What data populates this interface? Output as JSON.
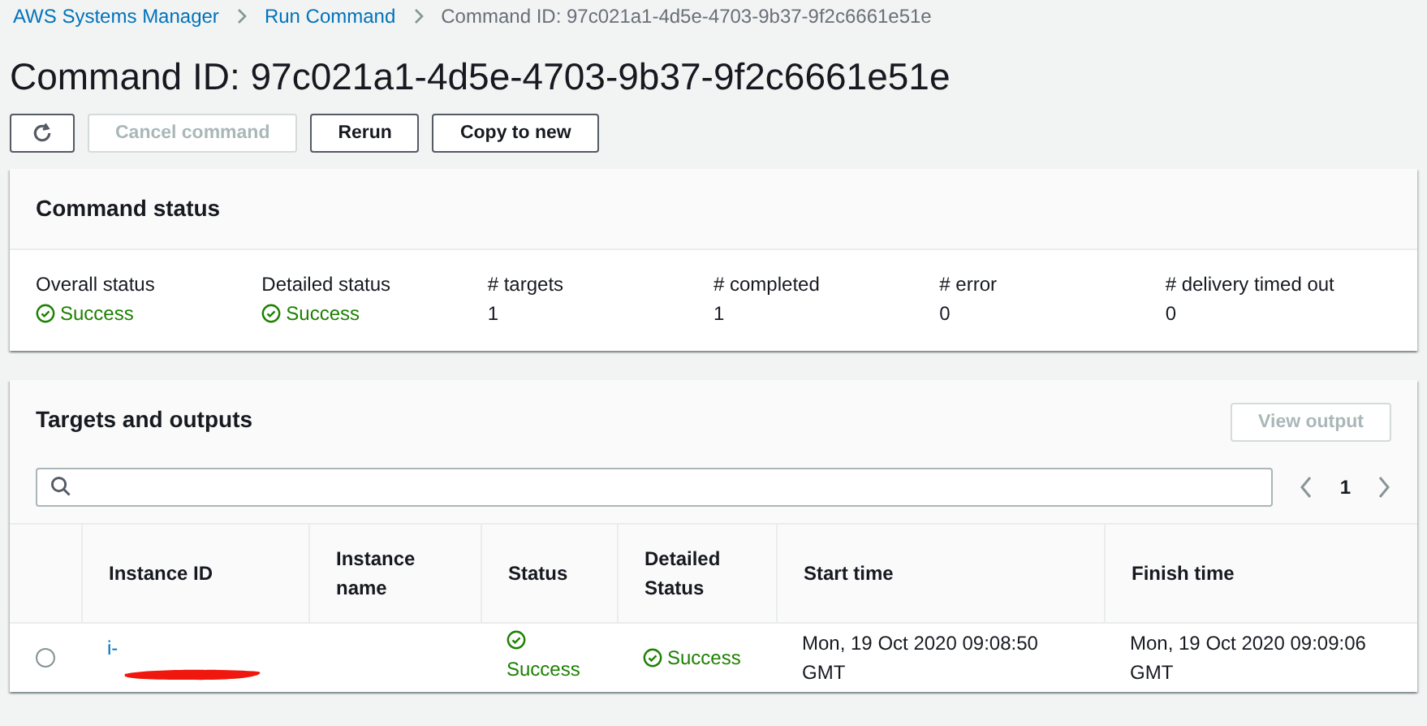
{
  "breadcrumbs": [
    {
      "label": "AWS Systems Manager",
      "link": true
    },
    {
      "label": "Run Command",
      "link": true
    },
    {
      "label": "Command ID: 97c021a1-4d5e-4703-9b37-9f2c6661e51e",
      "link": false
    }
  ],
  "title": "Command ID: 97c021a1-4d5e-4703-9b37-9f2c6661e51e",
  "actions": [
    {
      "kind": "refresh",
      "disabled": false
    },
    {
      "kind": "text",
      "label": "Cancel command",
      "disabled": true
    },
    {
      "kind": "text",
      "label": "Rerun",
      "disabled": false
    },
    {
      "kind": "text",
      "label": "Copy to new",
      "disabled": false
    }
  ],
  "command_status": {
    "title": "Command status",
    "fields": [
      {
        "kind": "status",
        "label": "Overall status",
        "value": "Success"
      },
      {
        "kind": "status",
        "label": "Detailed status",
        "value": "Success"
      },
      {
        "kind": "count",
        "label": "# targets",
        "value": "1"
      },
      {
        "kind": "count",
        "label": "# completed",
        "value": "1"
      },
      {
        "kind": "count",
        "label": "# error",
        "value": "0"
      },
      {
        "kind": "count",
        "label": "# delivery timed out",
        "value": "0"
      }
    ]
  },
  "targets": {
    "title": "Targets and outputs",
    "view_button": {
      "label": "View output",
      "disabled": true
    },
    "page": "1",
    "columns": [
      "Instance ID",
      "Instance name",
      "Status",
      "Detailed Status",
      "Start time",
      "Finish time"
    ],
    "rows": [
      {
        "selected": false,
        "instance_id": "i-",
        "redacted": true,
        "status": "Success",
        "status_ok": true,
        "detailed_status": "Success",
        "detailed_ok": true,
        "start": "Mon, 19 Oct 2020 09:08:50 GMT",
        "finish": "Mon, 19 Oct 2020 09:09:06 GMT"
      }
    ]
  }
}
